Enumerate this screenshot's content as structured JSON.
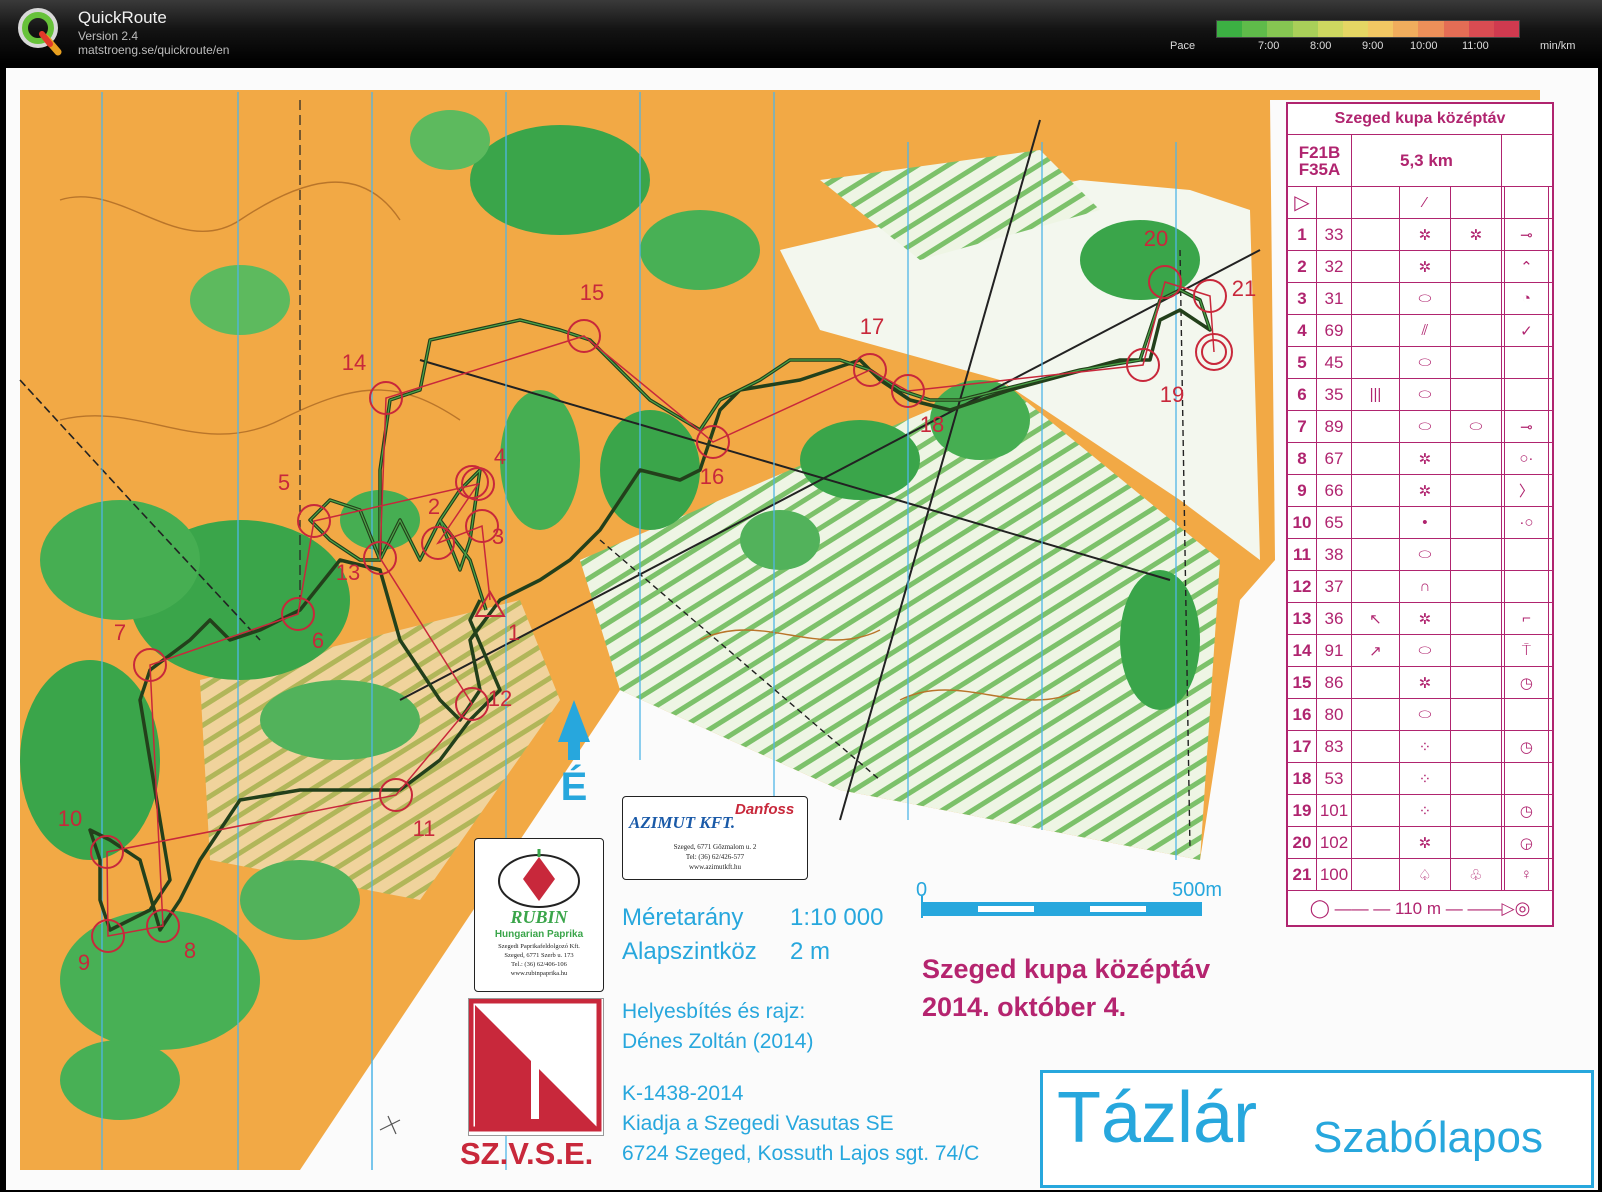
{
  "header": {
    "app_title": "QuickRoute",
    "version": "Version 2.4",
    "url": "matstroeng.se/quickroute/en",
    "pace_label": "Pace",
    "pace_ticks": [
      "7:00",
      "8:00",
      "9:00",
      "10:00",
      "11:00"
    ],
    "pace_unit": "min/km",
    "pace_colors": [
      "#3cb043",
      "#5fbb4a",
      "#86c652",
      "#a9cf59",
      "#cdd760",
      "#e5d664",
      "#f2c763",
      "#f0ad5d",
      "#ec8f59",
      "#e46d55",
      "#d94c52",
      "#cf3a4f"
    ]
  },
  "map": {
    "controls": [
      {
        "n": "1"
      },
      {
        "n": "2"
      },
      {
        "n": "3"
      },
      {
        "n": "4"
      },
      {
        "n": "5"
      },
      {
        "n": "6"
      },
      {
        "n": "7"
      },
      {
        "n": "8"
      },
      {
        "n": "9"
      },
      {
        "n": "10"
      },
      {
        "n": "11"
      },
      {
        "n": "12"
      },
      {
        "n": "13"
      },
      {
        "n": "14"
      },
      {
        "n": "15"
      },
      {
        "n": "16"
      },
      {
        "n": "17"
      },
      {
        "n": "18"
      },
      {
        "n": "19"
      },
      {
        "n": "20"
      },
      {
        "n": "21"
      }
    ],
    "north_letter": "É",
    "scale_start": "0",
    "scale_end": "500m",
    "scale_label": "Méretarány",
    "scale_value": "1:10 000",
    "contour_label": "Alapszintköz",
    "contour_value": "2 m",
    "credits_line1": "Helyesbítés és rajz:",
    "credits_line2": "Dénes Zoltán (2014)",
    "permit": "K-1438-2014",
    "publisher1": "Kiadja a Szegedi Vasutas SE",
    "publisher2": "6724 Szeged, Kossuth Lajos sgt. 74/C",
    "event_title1": "Szeged kupa középtáv",
    "event_title2": "2014. október 4.",
    "place_main": "Tázlár",
    "place_sub": "Szabólapos",
    "club_name": "SZ.V.S.E.",
    "sponsor1_name": "RUBIN",
    "sponsor1_sub": "Hungarian Paprika",
    "sponsor1_addr1": "Szegedi Paprikafeldolgozó Kft.",
    "sponsor1_addr2": "Szeged, 6771 Szerb u. 173",
    "sponsor1_addr3": "Tel.: (36) 62/406-106",
    "sponsor1_addr4": "www.rubinpaprika.hu",
    "sponsor2_name": "AZIMUT KFT.",
    "sponsor2_brand": "Danfoss",
    "sponsor2_addr1": "Szeged, 6771 Gőzmalom u. 2",
    "sponsor2_addr2": "Tel: (36) 62/426-577",
    "sponsor2_addr3": "www.azimutkft.hu"
  },
  "description": {
    "title": "Szeged kupa középtáv",
    "classes1": "F21B",
    "classes2": "F35A",
    "length": "5,3 km",
    "finish_distance": "110 m",
    "rows": [
      {
        "num": "1",
        "code": "33",
        "c": "",
        "d": "✲",
        "e": "✲",
        "g": "⊸"
      },
      {
        "num": "2",
        "code": "32",
        "c": "",
        "d": "✲",
        "e": "",
        "g": "⌃"
      },
      {
        "num": "3",
        "code": "31",
        "c": "",
        "d": "⬭",
        "e": "",
        "g": "◔"
      },
      {
        "num": "4",
        "code": "69",
        "c": "",
        "d": "⫽",
        "e": "",
        "g": "✓"
      },
      {
        "num": "5",
        "code": "45",
        "c": "",
        "d": "⬭",
        "e": "",
        "g": ""
      },
      {
        "num": "6",
        "code": "35",
        "c": "|||",
        "d": "⬭",
        "e": "",
        "g": ""
      },
      {
        "num": "7",
        "code": "89",
        "c": "",
        "d": "⬭",
        "e": "⬭",
        "g": "⊸"
      },
      {
        "num": "8",
        "code": "67",
        "c": "",
        "d": "✲",
        "e": "",
        "g": "○·"
      },
      {
        "num": "9",
        "code": "66",
        "c": "",
        "d": "✲",
        "e": "",
        "g": "〉"
      },
      {
        "num": "10",
        "code": "65",
        "c": "",
        "d": "•",
        "e": "",
        "g": "·○"
      },
      {
        "num": "11",
        "code": "38",
        "c": "",
        "d": "⬭",
        "e": "",
        "g": ""
      },
      {
        "num": "12",
        "code": "37",
        "c": "",
        "d": "∩",
        "e": "",
        "g": ""
      },
      {
        "num": "13",
        "code": "36",
        "c": "↖",
        "d": "✲",
        "e": "",
        "g": "⌐"
      },
      {
        "num": "14",
        "code": "91",
        "c": "↗",
        "d": "⬭",
        "e": "",
        "g": "⍑"
      },
      {
        "num": "15",
        "code": "86",
        "c": "",
        "d": "✲",
        "e": "",
        "g": "◷"
      },
      {
        "num": "16",
        "code": "80",
        "c": "",
        "d": "⬭",
        "e": "",
        "g": ""
      },
      {
        "num": "17",
        "code": "83",
        "c": "",
        "d": "⁘",
        "e": "",
        "g": "◷"
      },
      {
        "num": "18",
        "code": "53",
        "c": "",
        "d": "⁘",
        "e": "",
        "g": ""
      },
      {
        "num": "19",
        "code": "101",
        "c": "",
        "d": "⁘",
        "e": "",
        "g": "◷"
      },
      {
        "num": "20",
        "code": "102",
        "c": "",
        "d": "✲",
        "e": "",
        "g": "◶"
      },
      {
        "num": "21",
        "code": "100",
        "c": "",
        "d": "♤",
        "e": "♧",
        "g": "♀"
      }
    ]
  }
}
